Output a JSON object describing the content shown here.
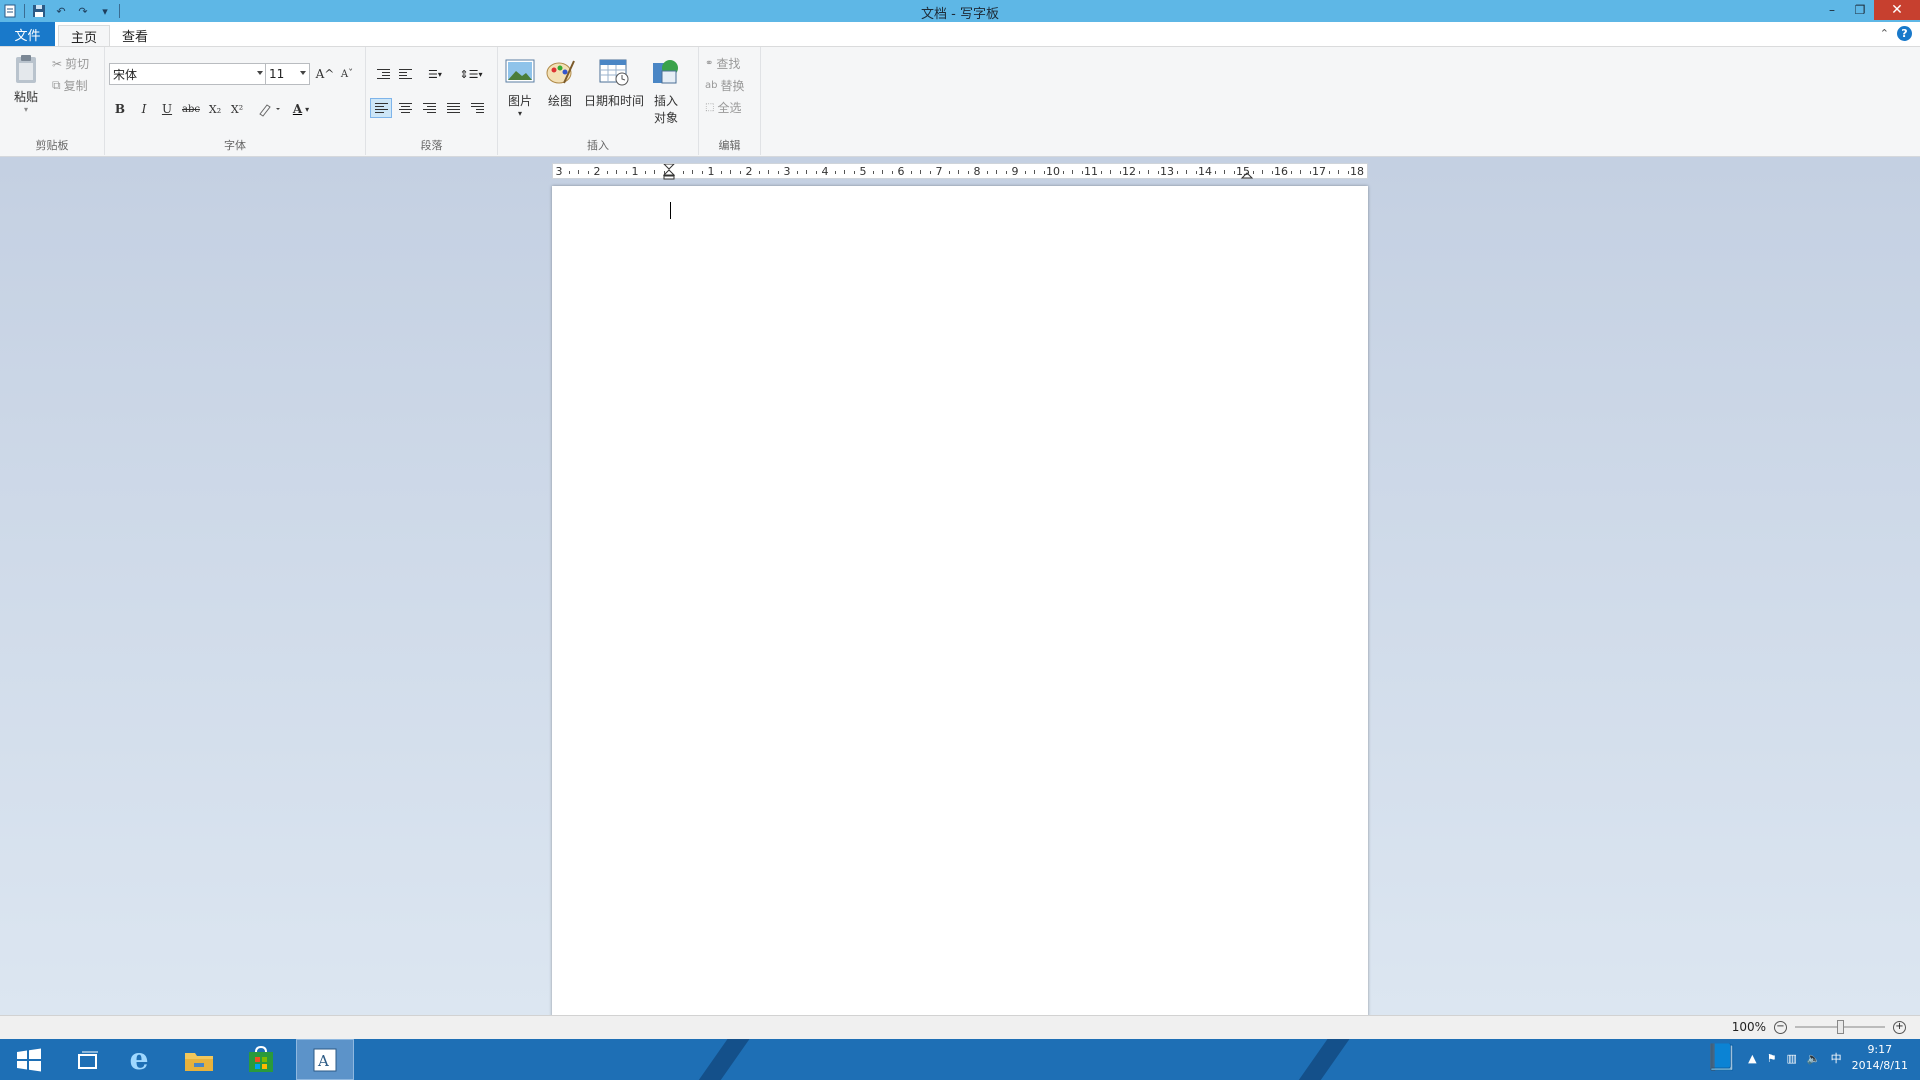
{
  "window": {
    "title": "文档 - 写字板"
  },
  "tabs": {
    "file": "文件",
    "home": "主页",
    "view": "查看"
  },
  "clipboard": {
    "paste": "粘贴",
    "cut": "剪切",
    "copy": "复制",
    "label": "剪贴板"
  },
  "font": {
    "family": "宋体",
    "size": "11",
    "label": "字体",
    "bold": "B",
    "italic": "I",
    "underline": "U",
    "strikethrough": "abc",
    "subscript": "X₂",
    "superscript": "X²",
    "grow": "A^",
    "shrink": "Aˇ",
    "color_letter": "A"
  },
  "paragraph": {
    "label": "段落"
  },
  "insert": {
    "picture": "图片",
    "paint": "绘图",
    "datetime": "日期和时间",
    "object_line1": "插入",
    "object_line2": "对象",
    "label": "插入"
  },
  "editing": {
    "find": "查找",
    "replace": "替换",
    "select_all": "全选",
    "label": "编辑"
  },
  "ruler": {
    "labels": [
      "3",
      "2",
      "1",
      "",
      "1",
      "2",
      "3",
      "4",
      "5",
      "6",
      "7",
      "8",
      "9",
      "10",
      "11",
      "12",
      "13",
      "14",
      "15",
      "16",
      "17",
      "18"
    ]
  },
  "status": {
    "zoom": "100%"
  },
  "taskbar": {
    "time": "9:17",
    "date": "2014/8/11",
    "ime": "中"
  },
  "colors": {
    "titlebar": "#5eb7e6",
    "file_tab": "#1979ca",
    "taskbar": "#1e6fb5",
    "close": "#c7402f"
  }
}
